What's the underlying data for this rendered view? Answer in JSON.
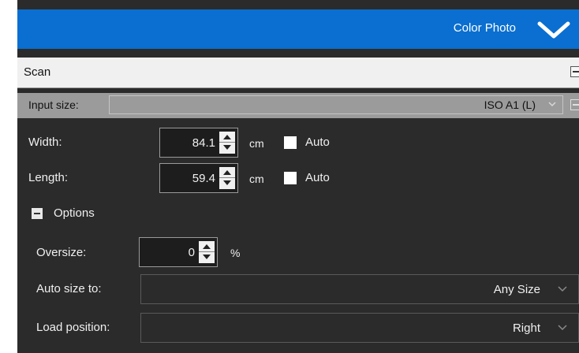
{
  "header": {
    "title": "Color Photo"
  },
  "scan": {
    "label": "Scan"
  },
  "input_size": {
    "label": "Input size:",
    "value": "ISO A1 (L)"
  },
  "width": {
    "label": "Width:",
    "value": "84.1",
    "unit": "cm",
    "auto_label": "Auto",
    "auto_checked": false
  },
  "length": {
    "label": "Length:",
    "value": "59.4",
    "unit": "cm",
    "auto_label": "Auto",
    "auto_checked": false
  },
  "options": {
    "label": "Options",
    "expanded": true
  },
  "oversize": {
    "label": "Oversize:",
    "value": "0",
    "unit": "%"
  },
  "auto_size": {
    "label": "Auto size to:",
    "value": "Any Size"
  },
  "load_position": {
    "label": "Load position:",
    "value": "Right"
  },
  "colors": {
    "header": "#0a6fd0",
    "panel": "#2b2b2b",
    "input_bar": "#9b9b9b"
  },
  "icons": {
    "header_toggle": "chevron-down-icon",
    "options_toggle": "collapse-icon"
  }
}
